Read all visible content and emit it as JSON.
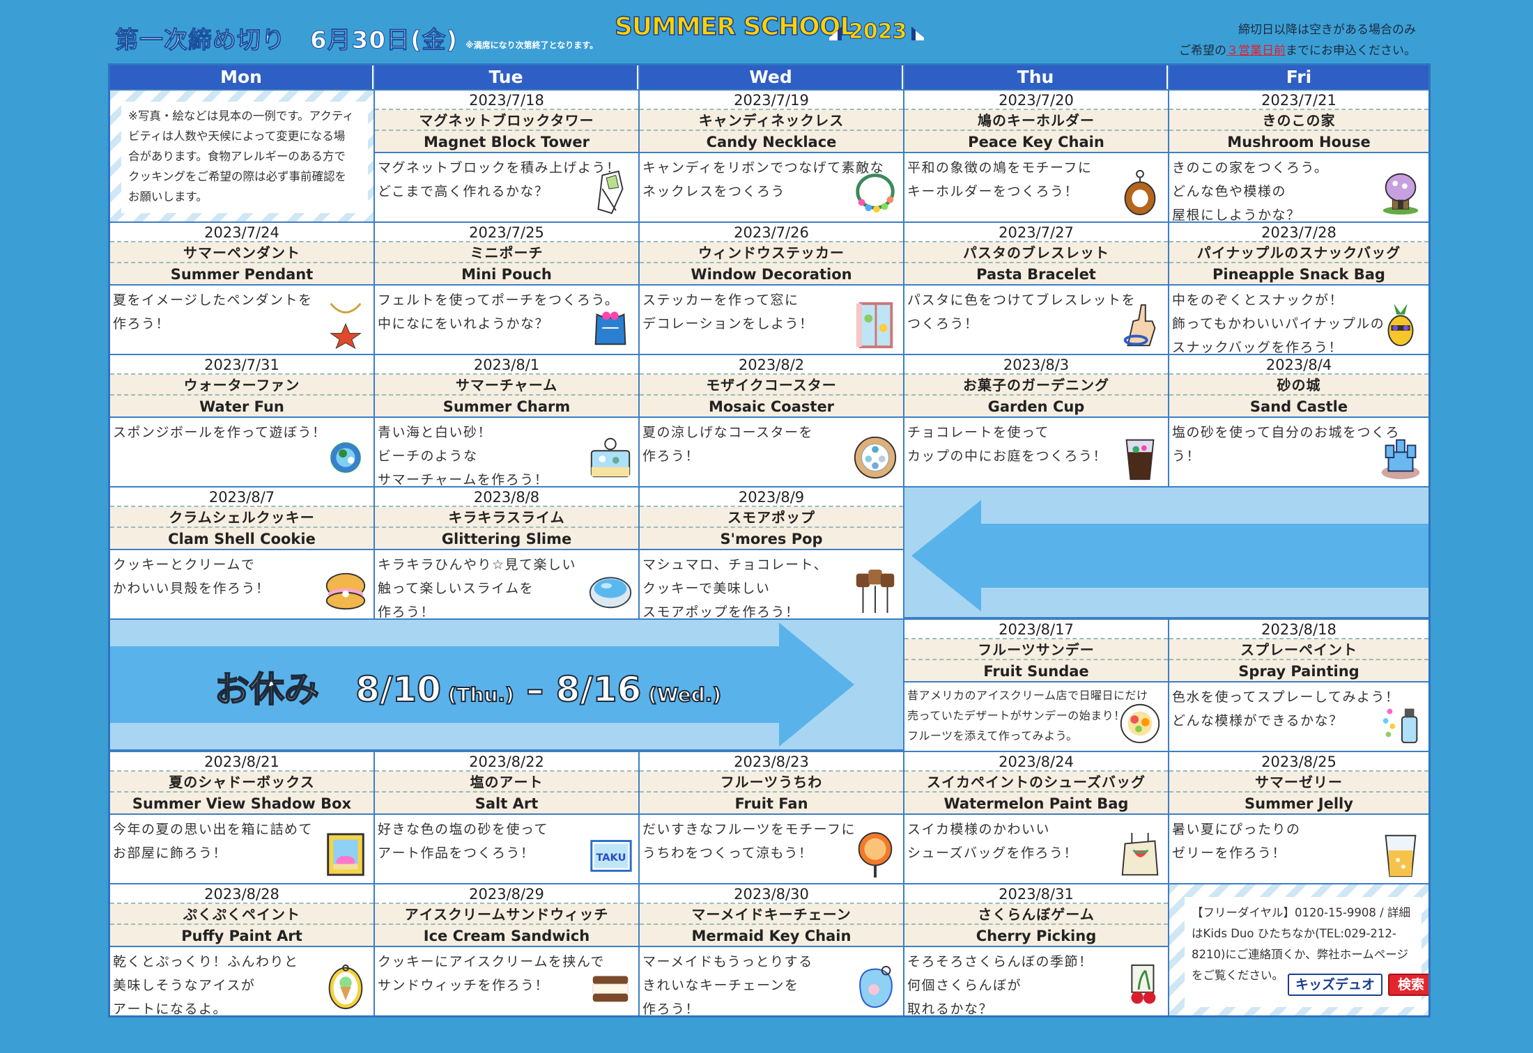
{
  "header": {
    "deadline": "第一次締め切り　6月30日(金)",
    "deadline_note": "※満席になり次第終了となります。",
    "logo": "SUMMER SCHOOL",
    "year": "2023",
    "note_line1": "締切日以降は空きがある場合のみ",
    "note_line2_pre": "ご希望の",
    "note_line2_red": "３営業日前",
    "note_line2_post": "までにお申込ください。"
  },
  "days": [
    "Mon",
    "Tue",
    "Wed",
    "Thu",
    "Fri"
  ],
  "notice": {
    "lines": [
      "※写真・絵などは見本の一例です。アクティ",
      "ビティは人数や天候によって変更になる場",
      "合があります。食物アレルギーのある方で",
      "クッキングをご希望の際は必ず事前確認を",
      "お願いします。"
    ]
  },
  "cells": [
    {
      "date": "2023/7/18",
      "jp": "マグネットブロックタワー",
      "en": "Magnet Block Tower",
      "desc": [
        "マグネットブロックを積み上げよう！",
        "どこまで高く作れるかな？"
      ],
      "icon": "magnet-tower-icon"
    },
    {
      "date": "2023/7/19",
      "jp": "キャンディネックレス",
      "en": "Candy Necklace",
      "desc": [
        "キャンディをリボンでつなげて素敵な",
        "ネックレスをつくろう"
      ],
      "icon": "necklace-icon"
    },
    {
      "date": "2023/7/20",
      "jp": "鳩のキーホルダー",
      "en": "Peace Key Chain",
      "desc": [
        "平和の象徴の鳩をモチーフに",
        "キーホルダーをつくろう！"
      ],
      "icon": "keychain-icon"
    },
    {
      "date": "2023/7/21",
      "jp": "きのこの家",
      "en": "Mushroom House",
      "desc": [
        "きのこの家をつくろう。",
        "どんな色や模様の",
        "屋根にしようかな？"
      ],
      "icon": "mushroom-house-icon"
    },
    {
      "date": "2023/7/24",
      "jp": "サマーペンダント",
      "en": "Summer Pendant",
      "desc": [
        "夏をイメージしたペンダントを",
        "作ろう！"
      ],
      "icon": "pendant-icon"
    },
    {
      "date": "2023/7/25",
      "jp": "ミニポーチ",
      "en": "Mini Pouch",
      "desc": [
        "フェルトを使ってポーチをつくろう。",
        "中になにをいれようかな？"
      ],
      "icon": "pouch-icon"
    },
    {
      "date": "2023/7/26",
      "jp": "ウィンドウステッカー",
      "en": "Window Decoration",
      "desc": [
        "ステッカーを作って窓に",
        "デコレーションをしよう！"
      ],
      "icon": "window-icon"
    },
    {
      "date": "2023/7/27",
      "jp": "パスタのブレスレット",
      "en": "Pasta Bracelet",
      "desc": [
        "パスタに色をつけてブレスレットを",
        "つくろう！"
      ],
      "icon": "bracelet-icon"
    },
    {
      "date": "2023/7/28",
      "jp": "パイナップルのスナックバッグ",
      "en": "Pineapple Snack Bag",
      "desc": [
        "中をのぞくとスナックが！",
        "飾ってもかわいいパイナップルの",
        "スナックバッグを作ろう！"
      ],
      "icon": "pineapple-icon"
    },
    {
      "date": "2023/7/31",
      "jp": "ウォーターファン",
      "en": "Water Fun",
      "desc": [
        "スポンジボールを作って遊ぼう！"
      ],
      "icon": "sponge-ball-icon"
    },
    {
      "date": "2023/8/1",
      "jp": "サマーチャーム",
      "en": "Summer Charm",
      "desc": [
        "青い海と白い砂！",
        "ビーチのような",
        "サマーチャームを作ろう！"
      ],
      "icon": "charm-icon"
    },
    {
      "date": "2023/8/2",
      "jp": "モザイクコースター",
      "en": "Mosaic Coaster",
      "desc": [
        "夏の涼しげなコースターを",
        "作ろう！"
      ],
      "icon": "coaster-icon"
    },
    {
      "date": "2023/8/3",
      "jp": "お菓子のガーデニング",
      "en": "Garden Cup",
      "desc": [
        "チョコレートを使って",
        "カップの中にお庭をつくろう！"
      ],
      "icon": "garden-cup-icon"
    },
    {
      "date": "2023/8/4",
      "jp": "砂の城",
      "en": "Sand Castle",
      "desc": [
        "塩の砂を使って自分のお城をつくろ",
        "う！"
      ],
      "icon": "castle-icon"
    },
    {
      "date": "2023/8/7",
      "jp": "クラムシェルクッキー",
      "en": "Clam Shell Cookie",
      "desc": [
        "クッキーとクリームで",
        "かわいい貝殻を作ろう！"
      ],
      "icon": "clam-cookie-icon"
    },
    {
      "date": "2023/8/8",
      "jp": "キラキラスライム",
      "en": "Glittering Slime",
      "desc": [
        "キラキラひんやり☆見て楽しい",
        "触って楽しいスライムを",
        "作ろう！"
      ],
      "icon": "slime-icon"
    },
    {
      "date": "2023/8/9",
      "jp": "スモアポップ",
      "en": "S'mores Pop",
      "desc": [
        "マシュマロ、チョコレート、",
        "クッキーで美味しい",
        "スモアポップを作ろう！"
      ],
      "icon": "smores-icon"
    },
    {
      "date": "2023/8/17",
      "jp": "フルーツサンデー",
      "en": "Fruit Sundae",
      "desc": [
        "昔アメリカのアイスクリーム店で日曜日にだけ",
        "売っていたデザートがサンデーの始まり！",
        "フルーツを添えて作ってみよう。"
      ],
      "icon": "sundae-icon",
      "small": true
    },
    {
      "date": "2023/8/18",
      "jp": "スプレーペイント",
      "en": "Spray Painting",
      "desc": [
        "色水を使ってスプレーしてみよう！",
        "どんな模様ができるかな？"
      ],
      "icon": "spray-icon"
    },
    {
      "date": "2023/8/21",
      "jp": "夏のシャドーボックス",
      "en": "Summer View Shadow Box",
      "desc": [
        "今年の夏の思い出を箱に詰めて",
        "お部屋に飾ろう！"
      ],
      "icon": "shadow-box-icon"
    },
    {
      "date": "2023/8/22",
      "jp": "塩のアート",
      "en": "Salt Art",
      "desc": [
        "好きな色の塩の砂を使って",
        "アート作品をつくろう！"
      ],
      "icon": "salt-art-icon",
      "icon_text": "TAKU"
    },
    {
      "date": "2023/8/23",
      "jp": "フルーツうちわ",
      "en": "Fruit Fan",
      "desc": [
        "だいすきなフルーツをモチーフに",
        "うちわをつくって涼もう！"
      ],
      "icon": "uchiwa-icon"
    },
    {
      "date": "2023/8/24",
      "jp": "スイカペイントのシューズバッグ",
      "en": "Watermelon Paint Bag",
      "desc": [
        "スイカ模様のかわいい",
        "シューズバッグを作ろう！"
      ],
      "icon": "shoe-bag-icon"
    },
    {
      "date": "2023/8/25",
      "jp": "サマーゼリー",
      "en": "Summer Jelly",
      "desc": [
        "暑い夏にぴったりの",
        "ゼリーを作ろう！"
      ],
      "icon": "jelly-icon"
    },
    {
      "date": "2023/8/28",
      "jp": "ぷくぷくペイント",
      "en": "Puffy Paint Art",
      "desc": [
        "乾くとぷっくり！ふんわりと",
        "美味しそうなアイスが",
        "アートになるよ。"
      ],
      "icon": "puffy-paint-icon"
    },
    {
      "date": "2023/8/29",
      "jp": "アイスクリームサンドウィッチ",
      "en": "Ice Cream Sandwich",
      "desc": [
        "クッキーにアイスクリームを挟んで",
        "サンドウィッチを作ろう！"
      ],
      "icon": "ice-sandwich-icon"
    },
    {
      "date": "2023/8/30",
      "jp": "マーメイドキーチェーン",
      "en": "Mermaid Key Chain",
      "desc": [
        "マーメイドもうっとりする",
        "きれいなキーチェーンを",
        "作ろう！"
      ],
      "icon": "mermaid-icon"
    },
    {
      "date": "2023/8/31",
      "jp": "さくらんぼゲーム",
      "en": "Cherry Picking",
      "desc": [
        "そろそろさくらんぼの季節！",
        "何個さくらんぼが",
        "取れるかな？"
      ],
      "icon": "cherry-icon"
    }
  ],
  "holiday": {
    "label": "お休み",
    "start": "8/10",
    "start_day": "(Thu.)",
    "dash": "–",
    "end": "8/16",
    "end_day": "(Wed.)"
  },
  "contact": {
    "lines": [
      "【フリーダイヤル】0120-15-9908 / 詳細",
      "はKids Duo ひたちなか(TEL:029-212-",
      "8210)にご連絡頂くか、弊社ホームページ",
      "をご覧ください。"
    ],
    "search_name": "キッズデュオ",
    "search_button": "検索"
  },
  "colors": {
    "background": "#3b9fd6",
    "header_blue": "#2e5fc4",
    "title_band": "#f6eee0",
    "arrow": "#5ab2ea",
    "accent_red": "#e3262e"
  }
}
